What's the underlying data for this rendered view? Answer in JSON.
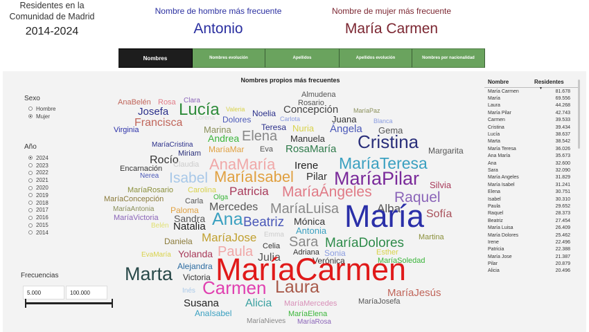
{
  "header": {
    "region_line1": "Residentes en la",
    "region_line2": "Comunidad de Madrid",
    "years": "2014-2024",
    "male_label": "Nombre de hombre más frecuente",
    "male_value": "Antonio",
    "female_label": "Nombre de mujer más frecuente",
    "female_value": "María Carmen"
  },
  "nav": {
    "tabs": [
      {
        "label": "Nombres",
        "active": true
      },
      {
        "label": "Nombres evolución",
        "active": false
      },
      {
        "label": "Apellidos",
        "active": false
      },
      {
        "label": "Apellidos evolución",
        "active": false
      },
      {
        "label": "Nombres por nacionalidad",
        "active": false
      }
    ]
  },
  "filters": {
    "sexo_label": "Sexo",
    "sexo_options": [
      {
        "label": "Hombre",
        "selected": false
      },
      {
        "label": "Mujer",
        "selected": true
      }
    ],
    "anio_label": "Año",
    "anio_options": [
      {
        "label": "2024",
        "selected": true
      },
      {
        "label": "2023",
        "selected": false
      },
      {
        "label": "2022",
        "selected": false
      },
      {
        "label": "2021",
        "selected": false
      },
      {
        "label": "2020",
        "selected": false
      },
      {
        "label": "2019",
        "selected": false
      },
      {
        "label": "2018",
        "selected": false
      },
      {
        "label": "2017",
        "selected": false
      },
      {
        "label": "2016",
        "selected": false
      },
      {
        "label": "2015",
        "selected": false
      },
      {
        "label": "2014",
        "selected": false
      }
    ],
    "freq_label": "Frecuencias",
    "freq_min": "5.000",
    "freq_max": "100.000"
  },
  "cloud": {
    "title": "Nombres propios más frecuentes",
    "words": [
      {
        "text": "Almudena",
        "color": "#555555"
      },
      {
        "text": "Rosario",
        "color": "#555555"
      },
      {
        "text": "AnaBelén",
        "color": "#c0655a"
      },
      {
        "text": "Rosa",
        "color": "#e07a86"
      },
      {
        "text": "Clara",
        "color": "#8a64b8"
      },
      {
        "text": "Lucía",
        "color": "#2e8b3a"
      },
      {
        "text": "Valeria",
        "color": "#d8d24a"
      },
      {
        "text": "Noelia",
        "color": "#2a2f8a"
      },
      {
        "text": "Concepción",
        "color": "#444444"
      },
      {
        "text": "MaríaPaz",
        "color": "#8a8f5a"
      },
      {
        "text": "Josefa",
        "color": "#2a2f8a"
      },
      {
        "text": "Lorena",
        "color": "#d9d9d9"
      },
      {
        "text": "Dolores",
        "color": "#4a58b8"
      },
      {
        "text": "Carlota",
        "color": "#8a9ce0"
      },
      {
        "text": "Juana",
        "color": "#333333"
      },
      {
        "text": "Blanca",
        "color": "#8a9ce0"
      },
      {
        "text": "Francisca",
        "color": "#c0655a"
      },
      {
        "text": "Teresa",
        "color": "#2a2f8a"
      },
      {
        "text": "Nuria",
        "color": "#d8d24a"
      },
      {
        "text": "Ángela",
        "color": "#4a58b8"
      },
      {
        "text": "Virginia",
        "color": "#2a2fa8"
      },
      {
        "text": "Marina",
        "color": "#8a8f5a"
      },
      {
        "text": "Gema",
        "color": "#555555"
      },
      {
        "text": "Andrea",
        "color": "#3ab53a"
      },
      {
        "text": "Elena",
        "color": "#888888"
      },
      {
        "text": "Manuela",
        "color": "#333333"
      },
      {
        "text": "Cristina",
        "color": "#2a2f7a"
      },
      {
        "text": "MaríaCristina",
        "color": "#2a2f8a"
      },
      {
        "text": "MaríaMar",
        "color": "#e0a040"
      },
      {
        "text": "Eva",
        "color": "#555555"
      },
      {
        "text": "RosaMaría",
        "color": "#2e7a4a"
      },
      {
        "text": "Margarita",
        "color": "#555555"
      },
      {
        "text": "Miriam",
        "color": "#2a2f7a"
      },
      {
        "text": "Rocío",
        "color": "#333333"
      },
      {
        "text": "Claudia",
        "color": "#cccccc"
      },
      {
        "text": "AnaMaría",
        "color": "#f0a8a8"
      },
      {
        "text": "Irene",
        "color": "#222222"
      },
      {
        "text": "MaríaTeresa",
        "color": "#3aa0c0"
      },
      {
        "text": "Encarnación",
        "color": "#333333"
      },
      {
        "text": "Nerea",
        "color": "#4a58b8"
      },
      {
        "text": "Isabel",
        "color": "#a8c8e8"
      },
      {
        "text": "MaríaIsabel",
        "color": "#e0a040"
      },
      {
        "text": "Pilar",
        "color": "#333333"
      },
      {
        "text": "MaríaPilar",
        "color": "#7a2a9a"
      },
      {
        "text": "Silvia",
        "color": "#a83a5a"
      },
      {
        "text": "MaríaRosario",
        "color": "#8a8f3a"
      },
      {
        "text": "Carolina",
        "color": "#d8d24a"
      },
      {
        "text": "Patricia",
        "color": "#a83a5a"
      },
      {
        "text": "MaríaÁngeles",
        "color": "#e07a86"
      },
      {
        "text": "Raquel",
        "color": "#8a64b8"
      },
      {
        "text": "MaríaConcepción",
        "color": "#8a7a3a"
      },
      {
        "text": "Carla",
        "color": "#555555"
      },
      {
        "text": "Olga",
        "color": "#3ab53a"
      },
      {
        "text": "MaríaAntonia",
        "color": "#8a8f5a"
      },
      {
        "text": "Paloma",
        "color": "#e0a040"
      },
      {
        "text": "Mercedes",
        "color": "#555555"
      },
      {
        "text": "MaríaLuisa",
        "color": "#888888"
      },
      {
        "text": "Alba",
        "color": "#555555"
      },
      {
        "text": "Sofía",
        "color": "#a8505a"
      },
      {
        "text": "MaríaVictoria",
        "color": "#8a64b8"
      },
      {
        "text": "Sandra",
        "color": "#555555"
      },
      {
        "text": "Ana",
        "color": "#3aa0c0"
      },
      {
        "text": "Beatriz",
        "color": "#4a58b8"
      },
      {
        "text": "Mónica",
        "color": "#333333"
      },
      {
        "text": "María",
        "color": "#2a2fa8"
      },
      {
        "text": "Belén",
        "color": "#e0e070"
      },
      {
        "text": "Natalia",
        "color": "#222222"
      },
      {
        "text": "Antonia",
        "color": "#3aa0c0"
      },
      {
        "text": "Emma",
        "color": "#cccccc"
      },
      {
        "text": "Daniela",
        "color": "#8a7a3a"
      },
      {
        "text": "MaríaJose",
        "color": "#c0a030"
      },
      {
        "text": "Sara",
        "color": "#888888"
      },
      {
        "text": "MaríaDolores",
        "color": "#2e8b4a"
      },
      {
        "text": "Martina",
        "color": "#8a8f3a"
      },
      {
        "text": "Celia",
        "color": "#333333"
      },
      {
        "text": "EvaMaría",
        "color": "#d8d24a"
      },
      {
        "text": "Yolanda",
        "color": "#a83a5a"
      },
      {
        "text": "Paula",
        "color": "#f0a8a8"
      },
      {
        "text": "Julia",
        "color": "#555555"
      },
      {
        "text": "Adriana",
        "color": "#333333"
      },
      {
        "text": "Sonia",
        "color": "#8a9ce0"
      },
      {
        "text": "Esther",
        "color": "#d8d24a"
      },
      {
        "text": "Alejandra",
        "color": "#2a6aa0"
      },
      {
        "text": "Verónica",
        "color": "#333333"
      },
      {
        "text": "MaríaSoledad",
        "color": "#3ab53a"
      },
      {
        "text": "Marta",
        "color": "#2a4a4a"
      },
      {
        "text": "Victoria",
        "color": "#333333"
      },
      {
        "text": "MaríaCarmen",
        "color": "#e01a1a"
      },
      {
        "text": "Inés",
        "color": "#a8c8e8"
      },
      {
        "text": "Carmen",
        "color": "#e040b0"
      },
      {
        "text": "Laura",
        "color": "#a85a4a"
      },
      {
        "text": "MaríaJesús",
        "color": "#c0655a"
      },
      {
        "text": "Susana",
        "color": "#222222"
      },
      {
        "text": "Alicia",
        "color": "#3aa0a0"
      },
      {
        "text": "MaríaMercedes",
        "color": "#d890b8"
      },
      {
        "text": "MaríaJosefa",
        "color": "#555555"
      },
      {
        "text": "AnaIsabel",
        "color": "#3aa0c0"
      },
      {
        "text": "MaríaElena",
        "color": "#3ab53a"
      },
      {
        "text": "MaríaNieves",
        "color": "#888888"
      },
      {
        "text": "MaríaRosa",
        "color": "#8a64b8"
      }
    ]
  },
  "table": {
    "col_name": "Nombre",
    "col_value": "Residentes",
    "rows": [
      {
        "name": "María Carmen",
        "value": "81.678"
      },
      {
        "name": "María",
        "value": "69.556"
      },
      {
        "name": "Laura",
        "value": "44.268"
      },
      {
        "name": "María Pilar",
        "value": "42.743"
      },
      {
        "name": "Carmen",
        "value": "39.533"
      },
      {
        "name": "Cristina",
        "value": "39.434"
      },
      {
        "name": "Lucía",
        "value": "38.637"
      },
      {
        "name": "Marta",
        "value": "38.542"
      },
      {
        "name": "María Teresa",
        "value": "36.026"
      },
      {
        "name": "Ana María",
        "value": "35.673"
      },
      {
        "name": "Ana",
        "value": "32.600"
      },
      {
        "name": "Sara",
        "value": "32.090"
      },
      {
        "name": "María Angeles",
        "value": "31.829"
      },
      {
        "name": "María Isabel",
        "value": "31.241"
      },
      {
        "name": "Elena",
        "value": "30.751"
      },
      {
        "name": "Isabel",
        "value": "30.310"
      },
      {
        "name": "Paula",
        "value": "29.652"
      },
      {
        "name": "Raquel",
        "value": "28.373"
      },
      {
        "name": "Beatriz",
        "value": "27.454"
      },
      {
        "name": "María Luisa",
        "value": "26.409"
      },
      {
        "name": "María Dolores",
        "value": "25.462"
      },
      {
        "name": "Irene",
        "value": "22.496"
      },
      {
        "name": "Patricia",
        "value": "22.388"
      },
      {
        "name": "María Jose",
        "value": "21.387"
      },
      {
        "name": "Pilar",
        "value": "20.879"
      },
      {
        "name": "Alicia",
        "value": "20.496"
      }
    ]
  }
}
